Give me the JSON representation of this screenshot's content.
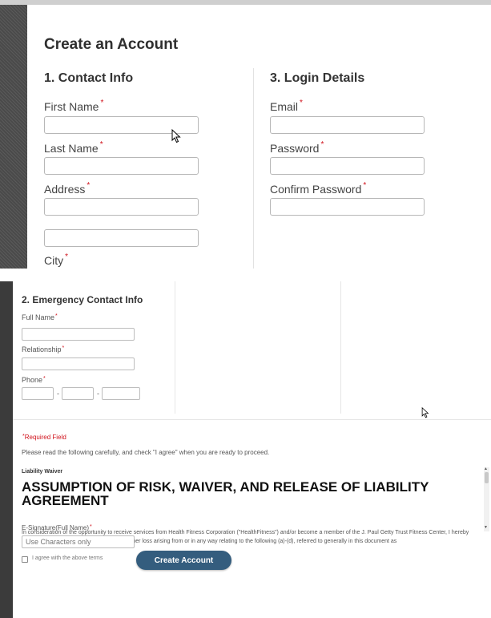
{
  "form": {
    "title": "Create an Account",
    "required_marker": "*",
    "contact": {
      "heading": "1. Contact Info",
      "first_name": "First Name",
      "last_name": "Last Name",
      "address": "Address",
      "city": "City"
    },
    "login": {
      "heading": "3. Login Details",
      "email": "Email",
      "password": "Password",
      "confirm_password": "Confirm Password"
    },
    "emergency": {
      "heading": "2. Emergency Contact Info",
      "full_name": "Full Name",
      "relationship": "Relationship",
      "phone": "Phone",
      "phone_separator": "-"
    },
    "required_field_note": "Required Field",
    "read_note": "Please read the following carefully, and check \"I agree\" when you are ready to proceed.",
    "waiver": {
      "label": "Liability Waiver",
      "title": "ASSUMPTION OF RISK, WAIVER, AND RELEASE OF LIABILITY AGREEMENT",
      "text": "In consideration of the opportunity to receive services from Health Fitness Corporation (\"HealthFitness\") and/or become a member of the J. Paul Getty Trust Fitness Center, I hereby assume all risks of injury, illness, death, or other loss arising from or in any way relating to the following (a)-(d), referred to generally in this document as"
    },
    "esignature": {
      "label": "E-Signature(Full Name)",
      "placeholder": "Use Characters only"
    },
    "agree_label": "I agree with the above terms",
    "submit_label": "Create Account"
  },
  "colors": {
    "required": "#d0111b",
    "button": "#345d7e",
    "sidebar": "#4a4a4a"
  }
}
